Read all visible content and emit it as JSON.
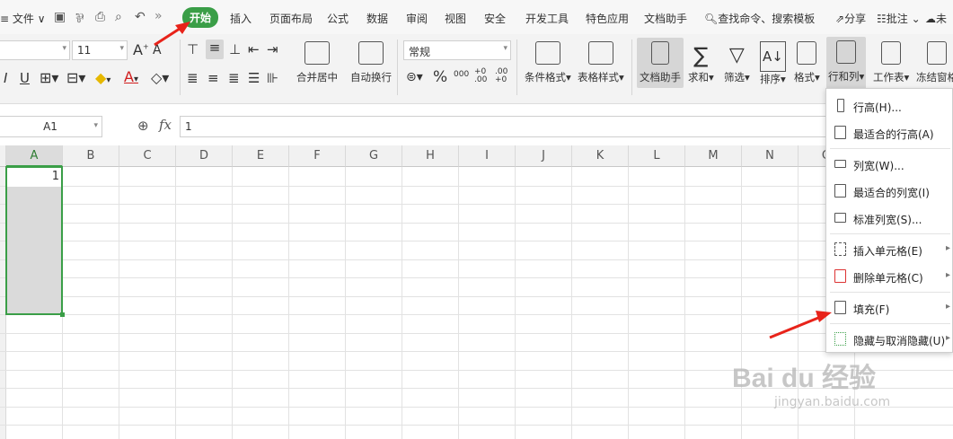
{
  "menubar": {
    "file": "文件",
    "tabs": [
      "开始",
      "插入",
      "页面布局",
      "公式",
      "数据",
      "审阅",
      "视图",
      "安全",
      "开发工具",
      "特色应用",
      "文档助手"
    ],
    "search_placeholder": "查找命令、搜索模板",
    "share": "分享",
    "comment": "批注",
    "user": "未"
  },
  "ribbon": {
    "font_size": "11",
    "number_format": "常规",
    "merge_center": "合并居中",
    "auto_wrap": "自动换行",
    "cond_format": "条件格式",
    "table_style": "表格样式",
    "doc_helper": "文档助手",
    "sum": "求和",
    "filter": "筛选",
    "sort": "排序",
    "format": "格式",
    "rowcol": "行和列",
    "worksheet": "工作表",
    "freeze": "冻结窗格",
    "percent": "%",
    "thousand": "000",
    "dec_inc": "+0 .00",
    "dec_dec": ".00 +0",
    "font_grow": "A",
    "font_shrink": "A",
    "italic": "I",
    "underline": "U",
    "font_color": "A"
  },
  "formula_bar": {
    "cell_ref": "A1",
    "fx": "fx",
    "value": "1"
  },
  "grid": {
    "columns": [
      "A",
      "B",
      "C",
      "D",
      "E",
      "F",
      "G",
      "H",
      "I",
      "J",
      "K",
      "L",
      "M",
      "N",
      "O"
    ],
    "cell_a1": "1"
  },
  "dropdown": {
    "items": [
      {
        "label": "行高(H)...",
        "submenu": false
      },
      {
        "label": "最适合的行高(A)",
        "submenu": false
      },
      {
        "label": "列宽(W)...",
        "submenu": false
      },
      {
        "label": "最适合的列宽(I)",
        "submenu": false
      },
      {
        "label": "标准列宽(S)...",
        "submenu": false
      },
      {
        "label": "插入单元格(E)",
        "submenu": true
      },
      {
        "label": "删除单元格(C)",
        "submenu": true
      },
      {
        "label": "填充(F)",
        "submenu": true
      },
      {
        "label": "隐藏与取消隐藏(U)",
        "submenu": true
      }
    ]
  },
  "watermark": {
    "brand": "Bai du 经验",
    "url": "jingyan.baidu.com"
  },
  "colors": {
    "accent": "#3a9e47",
    "arrow": "#e8231a"
  }
}
